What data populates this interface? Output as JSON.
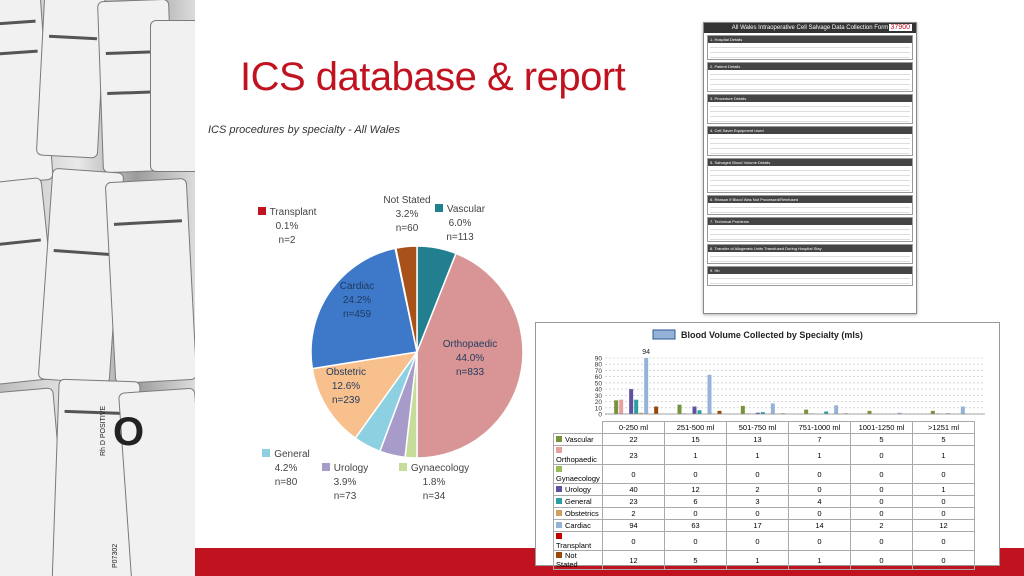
{
  "slide": {
    "title": "ICS database & report",
    "subtitle": "ICS procedures by specialty - All Wales"
  },
  "photo": {
    "bag_group": "O",
    "bag_text": "Rh D POSITIVE",
    "bag_code": "P07302"
  },
  "form": {
    "title": "All Wales Intraoperative Cell Salvage Data Collection Form",
    "number": "37900",
    "sections": [
      "1. Hospital Details",
      "2. Patient Details",
      "3. Procedure Details",
      "4. Cell Saver Equipment Used",
      "5. Salvaged Blood Volume Details",
      "6. Reason if Blood Was Not Processed/Reinfused",
      "7. Technical Problems",
      "8. Transfer of Allogeneic Units Transfused During Hospital Stay",
      "9. Hb"
    ]
  },
  "pie": {
    "colors": {
      "Vascular": "#217f8f",
      "Orthopaedic": "#d99595",
      "Gynaecology": "#c6dc9a",
      "Urology": "#a79bc9",
      "General": "#8dd0e1",
      "Obstetric": "#f8c08c",
      "Cardiac": "#3d78c9",
      "Transplant": "#c1121f",
      "Not Stated": "#a8521a"
    },
    "slices": [
      {
        "name": "Vascular",
        "pct": "6.0%",
        "n": "n=113",
        "value": 6.0
      },
      {
        "name": "Orthopaedic",
        "pct": "44.0%",
        "n": "n=833",
        "value": 44.0
      },
      {
        "name": "Gynaecology",
        "pct": "1.8%",
        "n": "n=34",
        "value": 1.8
      },
      {
        "name": "Urology",
        "pct": "3.9%",
        "n": "n=73",
        "value": 3.9
      },
      {
        "name": "General",
        "pct": "4.2%",
        "n": "n=80",
        "value": 4.2
      },
      {
        "name": "Obstetric",
        "pct": "12.6%",
        "n": "n=239",
        "value": 12.6
      },
      {
        "name": "Cardiac",
        "pct": "24.2%",
        "n": "n=459",
        "value": 24.2
      },
      {
        "name": "Transplant",
        "pct": "0.1%",
        "n": "n=2",
        "value": 0.1
      },
      {
        "name": "Not Stated",
        "pct": "3.2%",
        "n": "n=60",
        "value": 3.2
      }
    ]
  },
  "chart_data": {
    "type": "bar",
    "title": "Blood Volume Collected by Specialty (mls)",
    "categories": [
      "0-250 ml",
      "251-500 ml",
      "501-750 ml",
      "751-1000 ml",
      "1001-1250 ml",
      ">1251 ml"
    ],
    "ylim": [
      0,
      90
    ],
    "yticks": [
      0,
      10,
      20,
      30,
      40,
      50,
      60,
      70,
      80,
      90
    ],
    "annotation": "94",
    "legend_placement": "top",
    "series": [
      {
        "name": "Vascular",
        "color": "#77933c",
        "values": [
          22,
          15,
          13,
          7,
          5,
          5
        ]
      },
      {
        "name": "Orthopaedic",
        "color": "#e6a0a0",
        "values": [
          23,
          1,
          1,
          1,
          0,
          1
        ]
      },
      {
        "name": "Gynaecology",
        "color": "#9bbb59",
        "values": [
          0,
          0,
          0,
          0,
          0,
          0
        ]
      },
      {
        "name": "Urology",
        "color": "#6050a0",
        "values": [
          40,
          12,
          2,
          0,
          0,
          1
        ]
      },
      {
        "name": "General",
        "color": "#2ca0a0",
        "values": [
          23,
          6,
          3,
          4,
          0,
          0
        ]
      },
      {
        "name": "Obstetrics",
        "color": "#d0a060",
        "values": [
          2,
          0,
          0,
          0,
          0,
          0
        ]
      },
      {
        "name": "Cardiac",
        "color": "#95b3d7",
        "values": [
          94,
          63,
          17,
          14,
          2,
          12
        ]
      },
      {
        "name": "Transplant",
        "color": "#c00000",
        "values": [
          0,
          0,
          0,
          0,
          0,
          0
        ]
      },
      {
        "name": "Not Stated",
        "color": "#984807",
        "values": [
          12,
          5,
          1,
          1,
          0,
          0
        ]
      }
    ]
  }
}
